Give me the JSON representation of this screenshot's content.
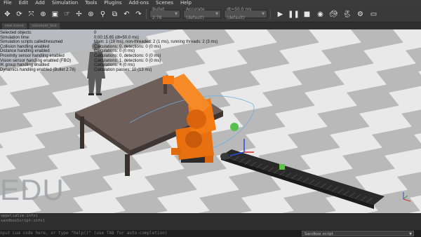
{
  "menu": [
    "File",
    "Edit",
    "Add",
    "Simulation",
    "Tools",
    "Plugins",
    "Add-ons",
    "Scenes",
    "Help"
  ],
  "toolbar": {
    "engine_combo": "Bullet 2.78",
    "accuracy_combo": "Accurate (default)",
    "timestep_combo": "dt=50.0 ms (default)"
  },
  "tabs": [
    "new scene",
    "conveyor_test"
  ],
  "info": {
    "labels": [
      "Selected objects:",
      "Simulation time:",
      "Simulation scripts called/resumed",
      "Collision handling enabled",
      "Distance handling enabled",
      "Proximity sensor handling enabled",
      "Vision sensor handling enabled (FBO)",
      "IK group handling enabled",
      "Dynamics handling enabled (Bullet 2.78)"
    ],
    "values": [
      "0",
      "0:00:15.65 (dt=50.0 ms)",
      "Main: 1 (19 ms), non-threaded: 2 (1 ms), running threads: 2 (3 ms)",
      "Calculations: 0, detections: 0 (0 ms)",
      "Calculations: 0 (0 ms)",
      "Calculations: 0, detections: 0 (0 ms)",
      "Calculations: 1, detections: 0 (0 ms)",
      "Calculations: 4 (0 ms)",
      "Calculation passes: 10 (13 ms)"
    ]
  },
  "watermark": "EDU",
  "status_lines": [
    {
      "text": "oppeliaSim:info]",
      "dim": " "
    },
    {
      "text": "sandboxScript:info]",
      "dim": " "
    }
  ],
  "command_line": {
    "placeholder": "nput Lua code here, or type \"help()\" (use TAB for auto-completion)"
  },
  "script_select": {
    "value": "Sandbox script"
  },
  "colors": {
    "robot": "#f47a14",
    "floor_light": "#e9e9e9",
    "floor_dark": "#b9b9b9",
    "table": "#6e5e5a",
    "accent": "#3fb24a"
  }
}
